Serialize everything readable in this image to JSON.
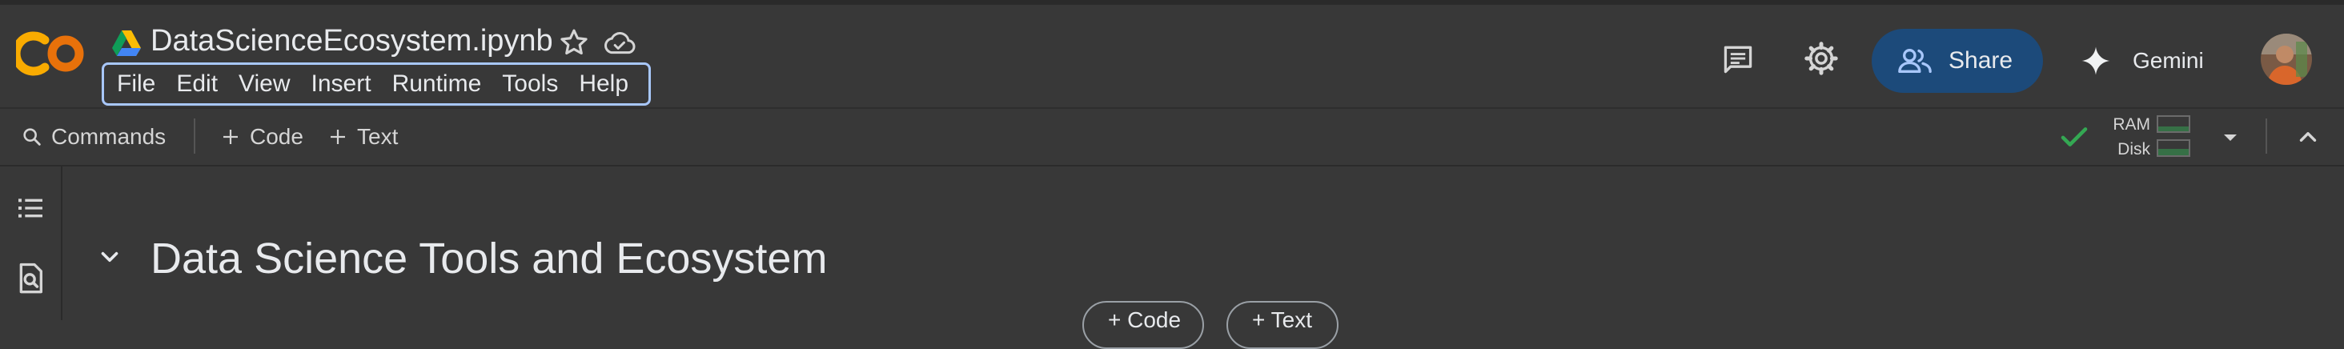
{
  "header": {
    "file_name": "DataScienceEcosystem.ipynb",
    "menu": [
      "File",
      "Edit",
      "View",
      "Insert",
      "Runtime",
      "Tools",
      "Help"
    ],
    "share_label": "Share",
    "gemini_label": "Gemini"
  },
  "toolbar": {
    "commands_label": "Commands",
    "code_label": "Code",
    "text_label": "Text",
    "ram_label": "RAM",
    "disk_label": "Disk"
  },
  "notebook": {
    "heading": "Data Science Tools and Ecosystem",
    "add_code_label": "+ Code",
    "add_text_label": "+ Text"
  },
  "icons": {
    "logo": "colab-logo-icon",
    "drive": "google-drive-icon",
    "star": "star-icon",
    "cloud": "cloud-saved-icon",
    "comment": "comment-icon",
    "settings": "gear-icon",
    "share": "people-icon",
    "gemini": "sparkle-icon",
    "search": "search-icon",
    "check": "check-icon",
    "dropdown": "dropdown-icon",
    "collapse": "chevron-up-icon",
    "toc": "table-of-contents-icon",
    "find": "find-icon",
    "caret": "chevron-down-icon"
  },
  "colors": {
    "background": "#383838",
    "share_button": "#1c4a7a",
    "menu_focus_ring": "#a8c7fa",
    "logo_orange": "#f9ab00",
    "check_green": "#34a853"
  }
}
